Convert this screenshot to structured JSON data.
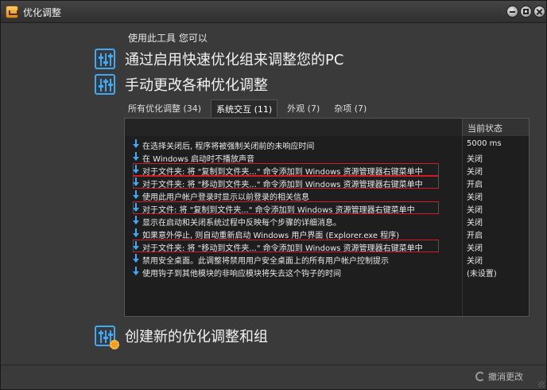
{
  "window": {
    "title": "优化调整"
  },
  "intro": "使用此工具 您可以",
  "actions": {
    "quick": "通过启用快速优化组来调整您的PC",
    "manual": "手动更改各种优化调整",
    "create": "创建新的优化调整和组"
  },
  "tabs": [
    {
      "label": "所有优化调整 (34)"
    },
    {
      "label": "系统交互 (11)"
    },
    {
      "label": "外观 (7)"
    },
    {
      "label": "杂项 (7)"
    }
  ],
  "table": {
    "status_header": "当前状态",
    "rows": [
      {
        "text": "在选择关闭后, 程序将被强制关闭前的未响应时间",
        "status": "5000 ms"
      },
      {
        "text": "在 Windows 启动时不播放声音",
        "status": "关闭"
      },
      {
        "text": "对于文件夹: 将 \"复制到文件夹...\" 命令添加到 Windows 资源管理器右键菜单中",
        "status": "关闭"
      },
      {
        "text": "对于文件夹: 将 \"移动到文件夹...\" 命令添加到 Windows 资源管理器右键菜单中",
        "status": "开启"
      },
      {
        "text": "使用此用户帐户登录时显示以前登录的相关信息",
        "status": "关闭"
      },
      {
        "text": "对于文件: 将 \"复制到文件夹...\" 命令添加到 Windows 资源管理器右键菜单中",
        "status": "关闭"
      },
      {
        "text": "显示在启动和关闭系统过程中反映每个步骤的详细消息。",
        "status": "关闭"
      },
      {
        "text": "如果意外停止, 则自动重新启动 Windows 用户界面 (Explorer.exe 程序)",
        "status": "开启"
      },
      {
        "text": "对于文件夹: 将 \"移动到文件夹...\" 命令添加到 Windows 资源管理器右键菜单中",
        "status": "关闭"
      },
      {
        "text": "禁用安全桌面。此调整将禁用用户安全桌面上的所有用户帐户控制提示",
        "status": "关闭"
      },
      {
        "text": "使用钩子到其他模块的非响应模块将失去这个钩子的时间",
        "status": "(未设置)"
      }
    ]
  },
  "footer": {
    "undo_label": "撤消更改"
  },
  "colors": {
    "accent_blue": "#3fa9f5",
    "highlight_red": "#d11a2a"
  }
}
